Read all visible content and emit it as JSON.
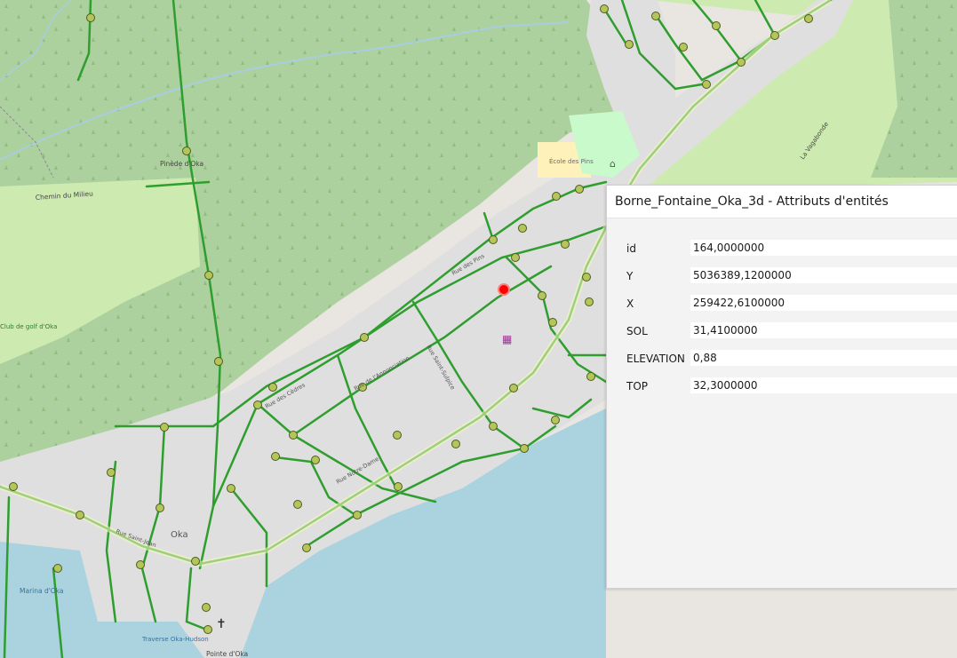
{
  "map": {
    "labels": {
      "chemin_milieu": "Chemin du Milieu",
      "pinede": "Pinède d'Oka",
      "oka": "Oka",
      "marina": "Marina d'Oka",
      "traverse": "Traverse Oka-Hudson",
      "pointe": "Pointe d'Oka",
      "ecole": "École des Pins",
      "club": "Club de golf d'Oka",
      "vagabonde": "La Vagabonde",
      "rue_notre_dame": "Rue Notre-Dame",
      "rue_des_pins": "Rue des Pins",
      "rue_de_l_annonciation": "Rue de l'Annonciation",
      "rue_saint_jean": "Rue Saint-Jean",
      "rue_des_cedres": "Rue des Cèdres",
      "rue_saint_sulpice": "Rue Saint-Sulpice"
    },
    "colors": {
      "forest": "#add19e",
      "urban": "#e0dfdf",
      "water": "#aad3df",
      "network": "#2e9e2e",
      "hydrant": "#b4c55a",
      "selected": "#ff0000"
    }
  },
  "panel": {
    "title": "Borne_Fontaine_Oka_3d - Attributs d'entités",
    "attributes": [
      {
        "name": "id",
        "value": "164,0000000"
      },
      {
        "name": "Y",
        "value": "5036389,1200000"
      },
      {
        "name": "X",
        "value": "259422,6100000"
      },
      {
        "name": "SOL",
        "value": "31,4100000"
      },
      {
        "name": "ELEVATION",
        "value": "0,88"
      },
      {
        "name": "TOP",
        "value": "32,3000000"
      }
    ]
  }
}
